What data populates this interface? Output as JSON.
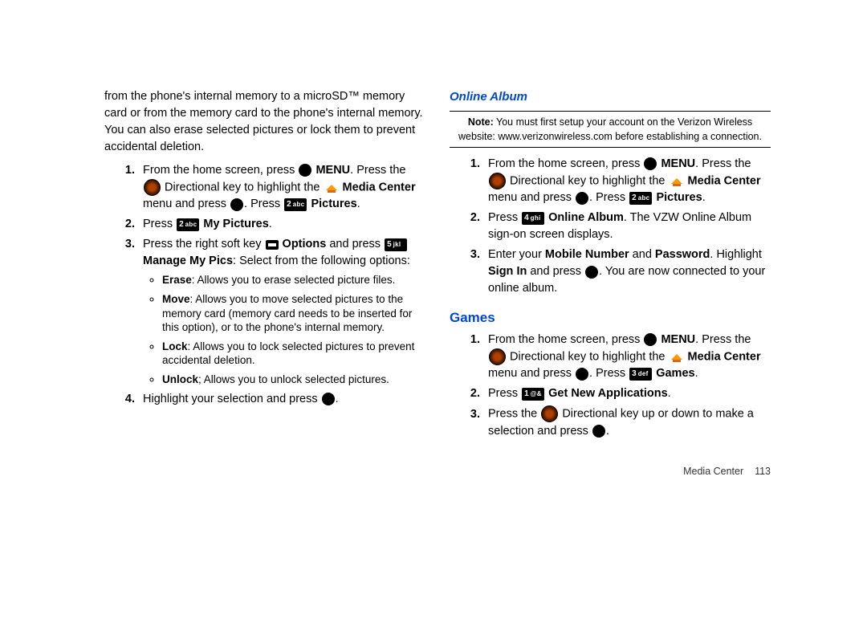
{
  "left": {
    "intro": "from the phone's internal memory to a microSD™ memory card or from the memory card to the phone's internal memory. You can also erase selected pictures or lock them to prevent accidental deletion.",
    "step1_a": "From the home screen, press ",
    "step1_menu": "MENU",
    "step1_b": ". Press the ",
    "step1_c": "Directional key to highlight the ",
    "step1_mc": "Media Center",
    "step1_d": " menu and press ",
    "step1_e": ". Press ",
    "step1_pics": "Pictures",
    "step2_a": "Press ",
    "step2_mypics": "My Pictures",
    "step3_a": "Press the right soft key ",
    "step3_options": "Options",
    "step3_b": " and press ",
    "step3_c": "Manage My Pics",
    "step3_d": ": Select from the following options:",
    "bullet_erase_b": "Erase",
    "bullet_erase_t": ": Allows you to erase selected picture files.",
    "bullet_move_b": "Move",
    "bullet_move_t": ": Allows you to move selected pictures to the memory card (memory card needs to be inserted for this option), or to the phone's internal memory.",
    "bullet_lock_b": "Lock",
    "bullet_lock_t": ": Allows you to lock selected pictures to prevent accidental deletion.",
    "bullet_unlock_b": "Unlock",
    "bullet_unlock_t": "; Allows you to unlock selected pictures.",
    "step4_a": "Highlight your selection and press ",
    "step4_b": "."
  },
  "right": {
    "h_online": "Online Album",
    "note_b": "Note:",
    "note_t": " You must first setup your account on the Verizon Wireless website: www.verizonwireless.com before establishing a connection.",
    "oa1_a": "From the home screen, press ",
    "oa1_menu": "MENU",
    "oa1_b": ". Press the ",
    "oa1_c": "Directional key to highlight the ",
    "oa1_mc": "Media Center",
    "oa1_d": " menu and press ",
    "oa1_e": ". Press ",
    "oa1_pics": "Pictures",
    "oa2_a": "Press ",
    "oa2_online": "Online Album",
    "oa2_b": ". The VZW Online Album sign-on screen displays.",
    "oa3_a": "Enter your ",
    "oa3_mn": "Mobile Number",
    "oa3_and": " and ",
    "oa3_pw": "Password",
    "oa3_b": ". Highlight ",
    "oa3_signin": "Sign In",
    "oa3_c": " and press ",
    "oa3_d": ". You are now connected to your online album.",
    "h_games": "Games",
    "g1_a": "From the home screen, press ",
    "g1_menu": "MENU",
    "g1_b": ". Press the ",
    "g1_c": "Directional key to highlight the ",
    "g1_mc": "Media Center",
    "g1_d": " menu and press ",
    "g1_e": ". Press ",
    "g1_games": "Games",
    "g2_a": "Press ",
    "g2_getnew": "Get New Applications",
    "g3_a": "Press the ",
    "g3_b": " Directional key up or down to make a selection and press ",
    "g3_c": "."
  },
  "keys": {
    "2abc_num": "2",
    "2abc_ltr": "abc",
    "4ghi_num": "4",
    "4ghi_ltr": "ghi",
    "5jkl_num": "5",
    "5jkl_ltr": "jkl",
    "3def_num": "3",
    "3def_ltr": "def",
    "1sym_num": "1",
    "1sym_ltr": "@&"
  },
  "footer": {
    "section": "Media Center",
    "page": "113"
  }
}
